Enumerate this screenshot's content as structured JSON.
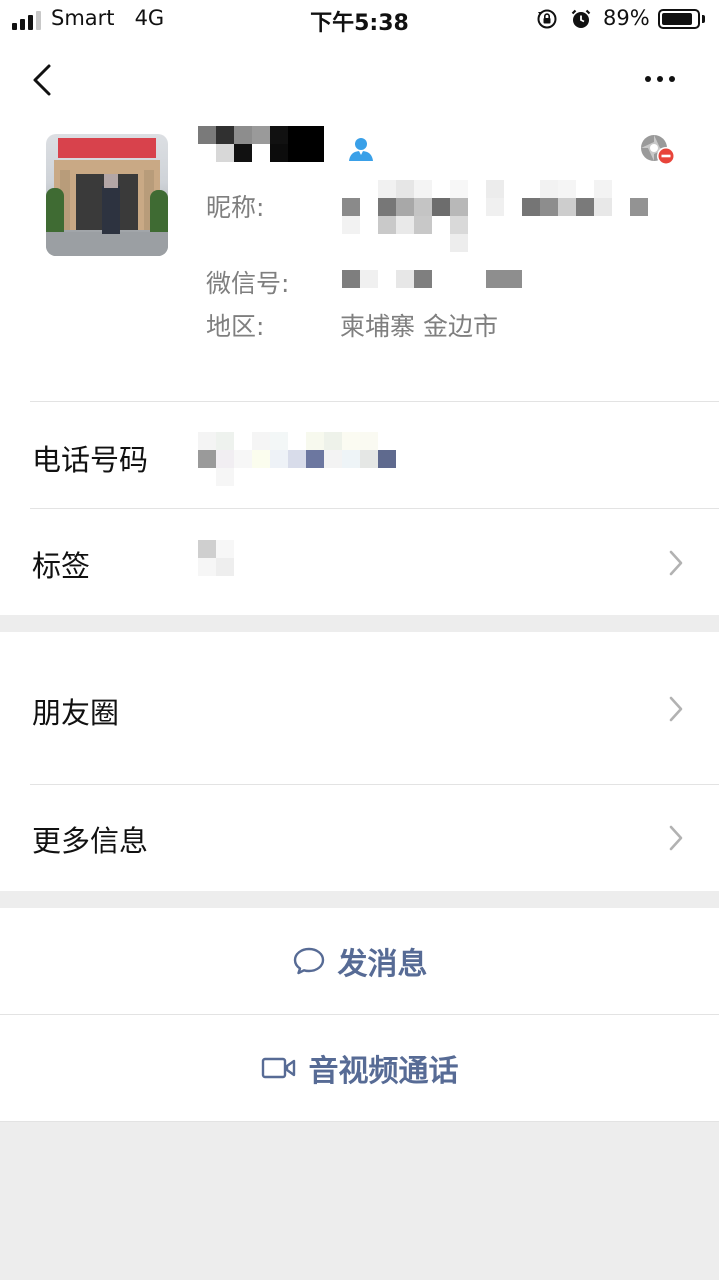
{
  "status_bar": {
    "carrier": "Smart",
    "network": "4G",
    "time": "下午5:38",
    "battery_percent": "89%",
    "battery_level": 0.89,
    "signal_bars": 3
  },
  "nav": {
    "back_icon": "chevron-left-icon",
    "more_icon": "ellipsis-icon"
  },
  "profile": {
    "name_icon": "contact-person-icon",
    "moments_icon": "moments-blocked-icon",
    "nickname_label": "昵称:",
    "wechat_id_label": "微信号:",
    "region_label": "地区:",
    "region_value": "柬埔寨 金边市"
  },
  "rows": {
    "phone_label": "电话号码",
    "tags_label": "标签",
    "moments_label": "朋友圈",
    "more_info_label": "更多信息"
  },
  "actions": {
    "message_label": "发消息",
    "call_label": "音视频通话"
  },
  "colors": {
    "accent": "#576b95",
    "contact_icon": "#3aa0e8",
    "block_badge": "#e8443a"
  }
}
